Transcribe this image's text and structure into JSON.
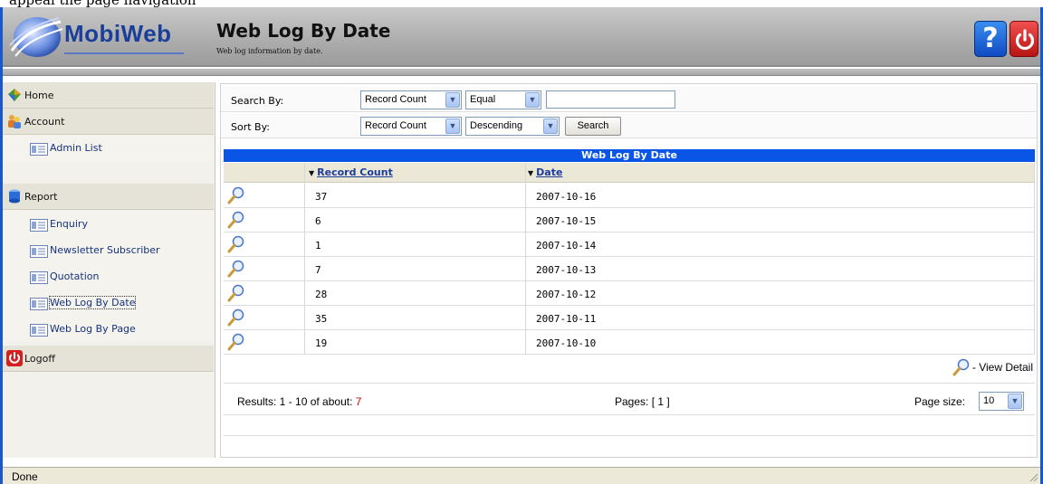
{
  "doc_strip_text": "appeal the page navigation",
  "header": {
    "logo_text": "MobiWeb",
    "title": "Web Log By Date",
    "subtitle": "Web log information by date.",
    "help_glyph": "?",
    "help_icon": "help-question-icon",
    "power_icon": "power-icon",
    "brand_color": "#1a3f99"
  },
  "sidebar": {
    "items": [
      {
        "label": "Home",
        "icon": "home-icon",
        "type": "section"
      },
      {
        "label": "Account",
        "icon": "users-icon",
        "type": "section"
      },
      {
        "label": "Admin List",
        "icon": "list-icon",
        "type": "sub"
      },
      {
        "label": "Report",
        "icon": "database-icon",
        "type": "section"
      },
      {
        "label": "Enquiry",
        "icon": "list-icon",
        "type": "sub"
      },
      {
        "label": "Newsletter Subscriber",
        "icon": "list-icon",
        "type": "sub"
      },
      {
        "label": "Quotation",
        "icon": "list-icon",
        "type": "sub"
      },
      {
        "label": "Web Log By Date",
        "icon": "list-icon",
        "type": "sub",
        "selected": true
      },
      {
        "label": "Web Log By Page",
        "icon": "list-icon",
        "type": "sub"
      },
      {
        "label": "Logoff",
        "icon": "power-icon",
        "type": "section"
      }
    ]
  },
  "filters": {
    "search_label": "Search By:",
    "search_field": "Record Count",
    "search_operator": "Equal",
    "search_value": "",
    "sort_label": "Sort By:",
    "sort_field": "Record Count",
    "sort_direction": "Descending",
    "search_button": "Search"
  },
  "grid": {
    "title": "Web Log By Date",
    "title_color": "#0a54e6",
    "columns": [
      "Record Count",
      "Date"
    ],
    "rows": [
      {
        "count": "37",
        "date": "2007-10-16"
      },
      {
        "count": "6",
        "date": "2007-10-15"
      },
      {
        "count": "1",
        "date": "2007-10-14"
      },
      {
        "count": "7",
        "date": "2007-10-13"
      },
      {
        "count": "28",
        "date": "2007-10-12"
      },
      {
        "count": "35",
        "date": "2007-10-11"
      },
      {
        "count": "19",
        "date": "2007-10-10"
      }
    ],
    "legend": "- View Detail"
  },
  "pager": {
    "results_prefix": "Results: 1 - 10 of about:",
    "results_total": "7",
    "pages_text": "Pages: [ 1 ]",
    "page_size_label": "Page size:",
    "page_size": "10"
  },
  "status": {
    "text": "Done"
  }
}
